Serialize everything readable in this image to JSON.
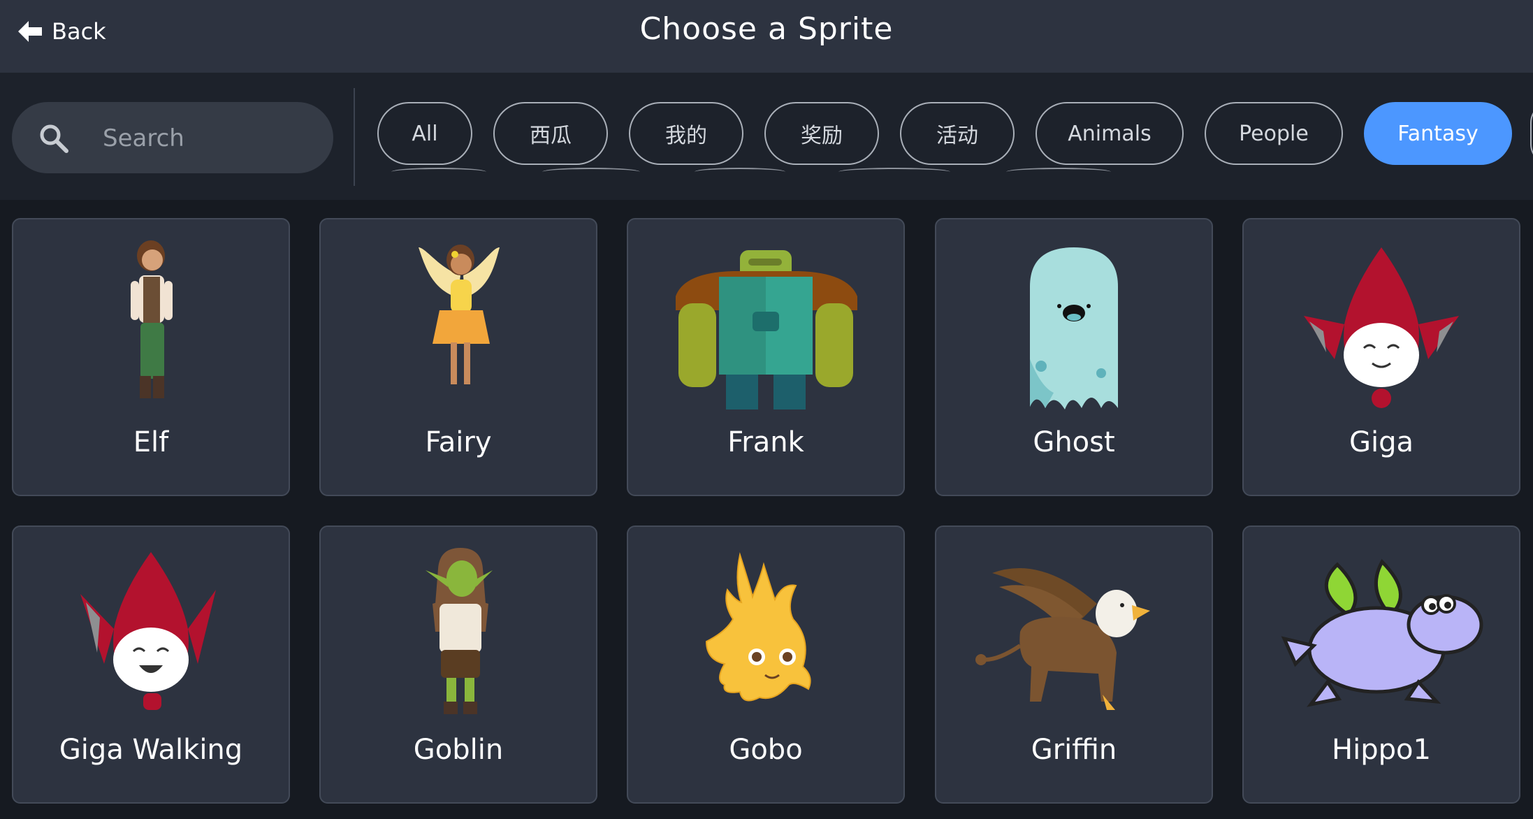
{
  "header": {
    "back_label": "Back",
    "title": "Choose a Sprite"
  },
  "search": {
    "placeholder": "Search",
    "value": ""
  },
  "tags": [
    {
      "label": "All",
      "active": false
    },
    {
      "label": "西瓜",
      "active": false
    },
    {
      "label": "我的",
      "active": false
    },
    {
      "label": "奖励",
      "active": false
    },
    {
      "label": "活动",
      "active": false
    },
    {
      "label": "Animals",
      "active": false
    },
    {
      "label": "People",
      "active": false
    },
    {
      "label": "Fantasy",
      "active": true
    }
  ],
  "colors": {
    "accent": "#4c97ff",
    "header_bg": "#2d3340",
    "page_bg": "#161a21",
    "card_bg": "#2d3340"
  },
  "sprites": [
    {
      "name": "Elf",
      "icon": "elf-icon"
    },
    {
      "name": "Fairy",
      "icon": "fairy-icon"
    },
    {
      "name": "Frank",
      "icon": "frank-icon"
    },
    {
      "name": "Ghost",
      "icon": "ghost-icon"
    },
    {
      "name": "Giga",
      "icon": "giga-icon"
    },
    {
      "name": "Giga Walking",
      "icon": "giga-walking-icon"
    },
    {
      "name": "Goblin",
      "icon": "goblin-icon"
    },
    {
      "name": "Gobo",
      "icon": "gobo-icon"
    },
    {
      "name": "Griffin",
      "icon": "griffin-icon"
    },
    {
      "name": "Hippo1",
      "icon": "hippo-icon"
    }
  ]
}
